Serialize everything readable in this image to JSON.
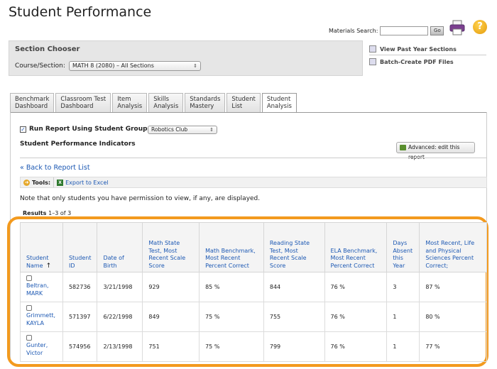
{
  "page": {
    "title": "Student Performance"
  },
  "header": {
    "materials_search_label": "Materials Search:",
    "materials_search_value": "",
    "go_label": "Go",
    "help_label": "?"
  },
  "section_chooser": {
    "title": "Section Chooser",
    "course_label": "Course/Section:",
    "course_value": "MATH 8 (2080) – All Sections"
  },
  "side_links": {
    "past_year": "View Past Year Sections",
    "batch_pdf": "Batch-Create PDF Files"
  },
  "tabs": [
    {
      "line1": "Benchmark",
      "line2": "Dashboard"
    },
    {
      "line1": "Classroom Test",
      "line2": "Dashboard"
    },
    {
      "line1": "Item",
      "line2": "Analysis"
    },
    {
      "line1": "Skills",
      "line2": "Analysis"
    },
    {
      "line1": "Standards",
      "line2": "Mastery"
    },
    {
      "line1": "Student",
      "line2": "List"
    },
    {
      "line1": "Student",
      "line2": "Analysis"
    }
  ],
  "active_tab": 6,
  "report": {
    "run_label": "Run Report Using Student Group:",
    "group_value": "Robotics Club",
    "indicators_title": "Student Performance Indicators",
    "advanced_label": "Advanced: edit this report",
    "back_link": "« Back to Report List",
    "tools_label": "Tools:",
    "export_label": "Export to Excel",
    "note": "Note that only students you have permission to view, if any, are displayed.",
    "results_label": "Results",
    "results_range": "1–3 of 3"
  },
  "table": {
    "columns": [
      "Student Name",
      "Student ID",
      "Date of Birth",
      "Math State Test, Most Recent Scale Score",
      "Math Benchmark, Most Recent Percent Correct",
      "Reading State Test, Most Recent Scale Score",
      "ELA Benchmark, Most Recent Percent Correct",
      "Days Absent this Year",
      "Most Recent, Life and Physical Sciences Percent Correct;"
    ],
    "rows": [
      {
        "name_last": "Beltran,",
        "name_first": "MARK",
        "id": "582736",
        "dob": "3/21/1998",
        "math_state": "929",
        "math_bench": "85 %",
        "reading_state": "844",
        "ela_bench": "76 %",
        "absent": "3",
        "science": "87 %"
      },
      {
        "name_last": "Grimmett,",
        "name_first": "KAYLA",
        "id": "571397",
        "dob": "6/22/1998",
        "math_state": "849",
        "math_bench": "75 %",
        "reading_state": "755",
        "ela_bench": "76 %",
        "absent": "1",
        "science": "80 %"
      },
      {
        "name_last": "Gunter,",
        "name_first": "Victor",
        "id": "574956",
        "dob": "2/13/1998",
        "math_state": "751",
        "math_bench": "75 %",
        "reading_state": "799",
        "ela_bench": "76 %",
        "absent": "1",
        "science": "77 %"
      }
    ]
  },
  "colors": {
    "link": "#1c58b3",
    "highlight": "#f39a1e",
    "panel_bg": "#e6e6e6"
  }
}
